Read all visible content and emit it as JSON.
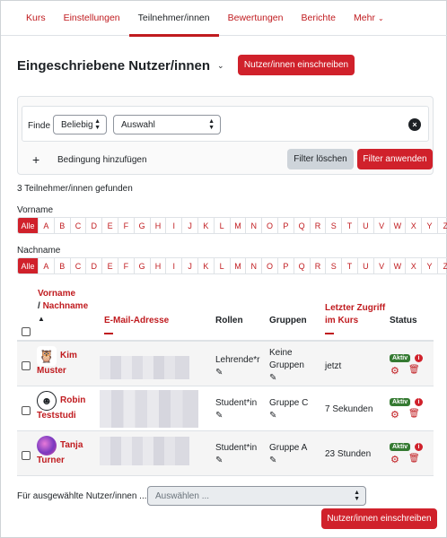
{
  "nav": {
    "tabs": [
      {
        "label": "Kurs"
      },
      {
        "label": "Einstellungen"
      },
      {
        "label": "Teilnehmer/innen"
      },
      {
        "label": "Bewertungen"
      },
      {
        "label": "Berichte"
      },
      {
        "label": "Mehr"
      }
    ]
  },
  "page": {
    "title": "Eingeschriebene Nutzer/innen",
    "enrol_button": "Nutzer/innen einschreiben"
  },
  "filter": {
    "finde_label": "Finde",
    "match_select": "Beliebig",
    "type_select": "Auswahl",
    "add_condition": "Bedingung hinzufügen",
    "clear_button": "Filter löschen",
    "apply_button": "Filter anwenden"
  },
  "found_text": "3 Teilnehmer/innen gefunden",
  "firstname_filter": {
    "label": "Vorname",
    "letters": [
      "Alle",
      "A",
      "B",
      "C",
      "D",
      "E",
      "F",
      "G",
      "H",
      "I",
      "J",
      "K",
      "L",
      "M",
      "N",
      "O",
      "P",
      "Q",
      "R",
      "S",
      "T",
      "U",
      "V",
      "W",
      "X",
      "Y",
      "Z"
    ]
  },
  "lastname_filter": {
    "label": "Nachname",
    "letters": [
      "Alle",
      "A",
      "B",
      "C",
      "D",
      "E",
      "F",
      "G",
      "H",
      "I",
      "J",
      "K",
      "L",
      "M",
      "N",
      "O",
      "P",
      "Q",
      "R",
      "S",
      "T",
      "U",
      "V",
      "W",
      "X",
      "Y",
      "Z"
    ]
  },
  "table": {
    "headers": {
      "name_first": "Vorname",
      "name_last": "/ Nachname",
      "email": "E-Mail-Adresse",
      "roles": "Rollen",
      "groups": "Gruppen",
      "lastaccess_1": "Letzter Zugriff",
      "lastaccess_2": "im Kurs",
      "status": "Status"
    },
    "rows": [
      {
        "first": "Kim",
        "last": "Muster",
        "role": "Lehrende*r",
        "group1": "Keine",
        "group2": "Gruppen",
        "last_access": "jetzt",
        "status": "Aktiv",
        "avatar_icon": "owl-icon"
      },
      {
        "first": "Robin",
        "last": "Teststudi",
        "role": "Student*in",
        "group1": "Gruppe C",
        "group2": "",
        "last_access": "7 Sekunden",
        "status": "Aktiv",
        "avatar_icon": "smiley-icon"
      },
      {
        "first": "Tanja",
        "last": "Turner",
        "role": "Student*in",
        "group1": "Gruppe A",
        "group2": "",
        "last_access": "23 Stunden",
        "status": "Aktiv",
        "avatar_icon": "photo-avatar"
      }
    ]
  },
  "bulk": {
    "label": "Für ausgewählte Nutzer/innen ...",
    "placeholder": "Auswählen ..."
  },
  "colors": {
    "accent": "#d0212b",
    "active_badge": "#357a32"
  }
}
